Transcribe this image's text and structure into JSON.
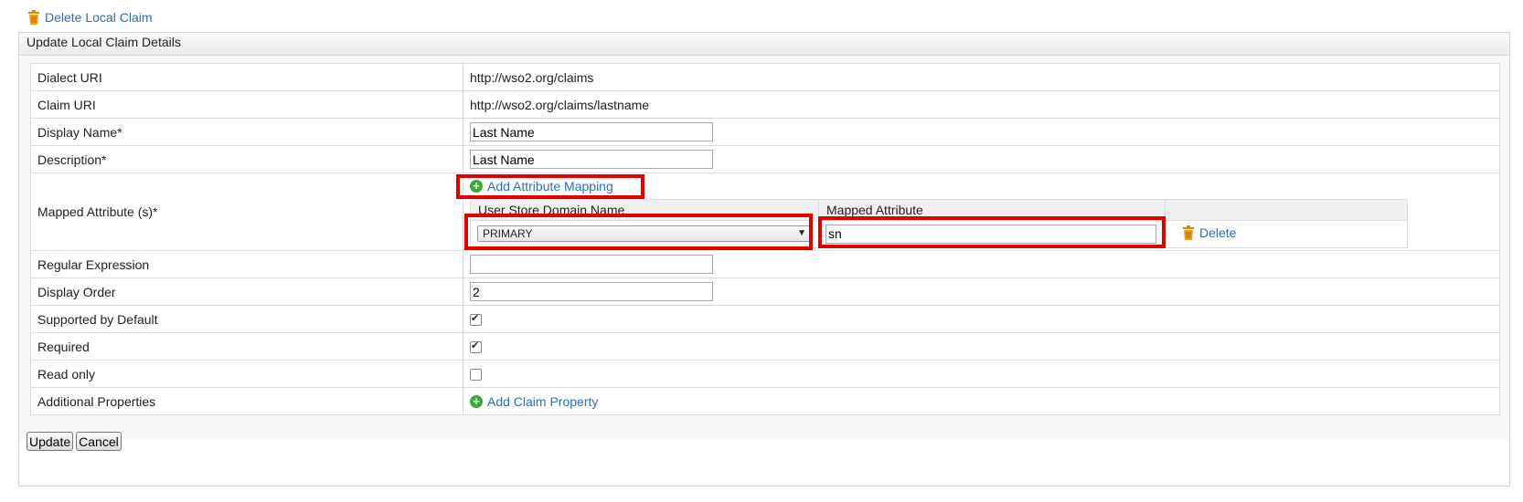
{
  "top": {
    "delete_label": "Delete Local Claim"
  },
  "panel": {
    "title": "Update Local Claim Details"
  },
  "fields": {
    "dialect_label": "Dialect URI",
    "dialect_value": "http://wso2.org/claims",
    "claim_label": "Claim URI",
    "claim_value": "http://wso2.org/claims/lastname",
    "display_name_label": "Display Name*",
    "display_name_value": "Last Name",
    "description_label": "Description*",
    "description_value": "Last Name",
    "mapped_label": "Mapped Attribute (s)*",
    "add_mapping_label": "Add Attribute Mapping",
    "col_domain": "User Store Domain Name",
    "col_attribute": "Mapped Attribute",
    "domain_selected": "PRIMARY",
    "attribute_value": "sn",
    "delete_row_label": "Delete",
    "regex_label": "Regular Expression",
    "regex_value": "",
    "order_label": "Display Order",
    "order_value": "2",
    "supported_label": "Supported by Default",
    "supported_checked": true,
    "required_label": "Required",
    "required_checked": true,
    "readonly_label": "Read only",
    "readonly_checked": false,
    "additional_label": "Additional Properties",
    "add_property_label": "Add Claim Property"
  },
  "buttons": {
    "update": "Update",
    "cancel": "Cancel"
  },
  "colors": {
    "link": "#2a6ebb",
    "highlight": "#e00000",
    "add_icon": "#3aa83a"
  }
}
